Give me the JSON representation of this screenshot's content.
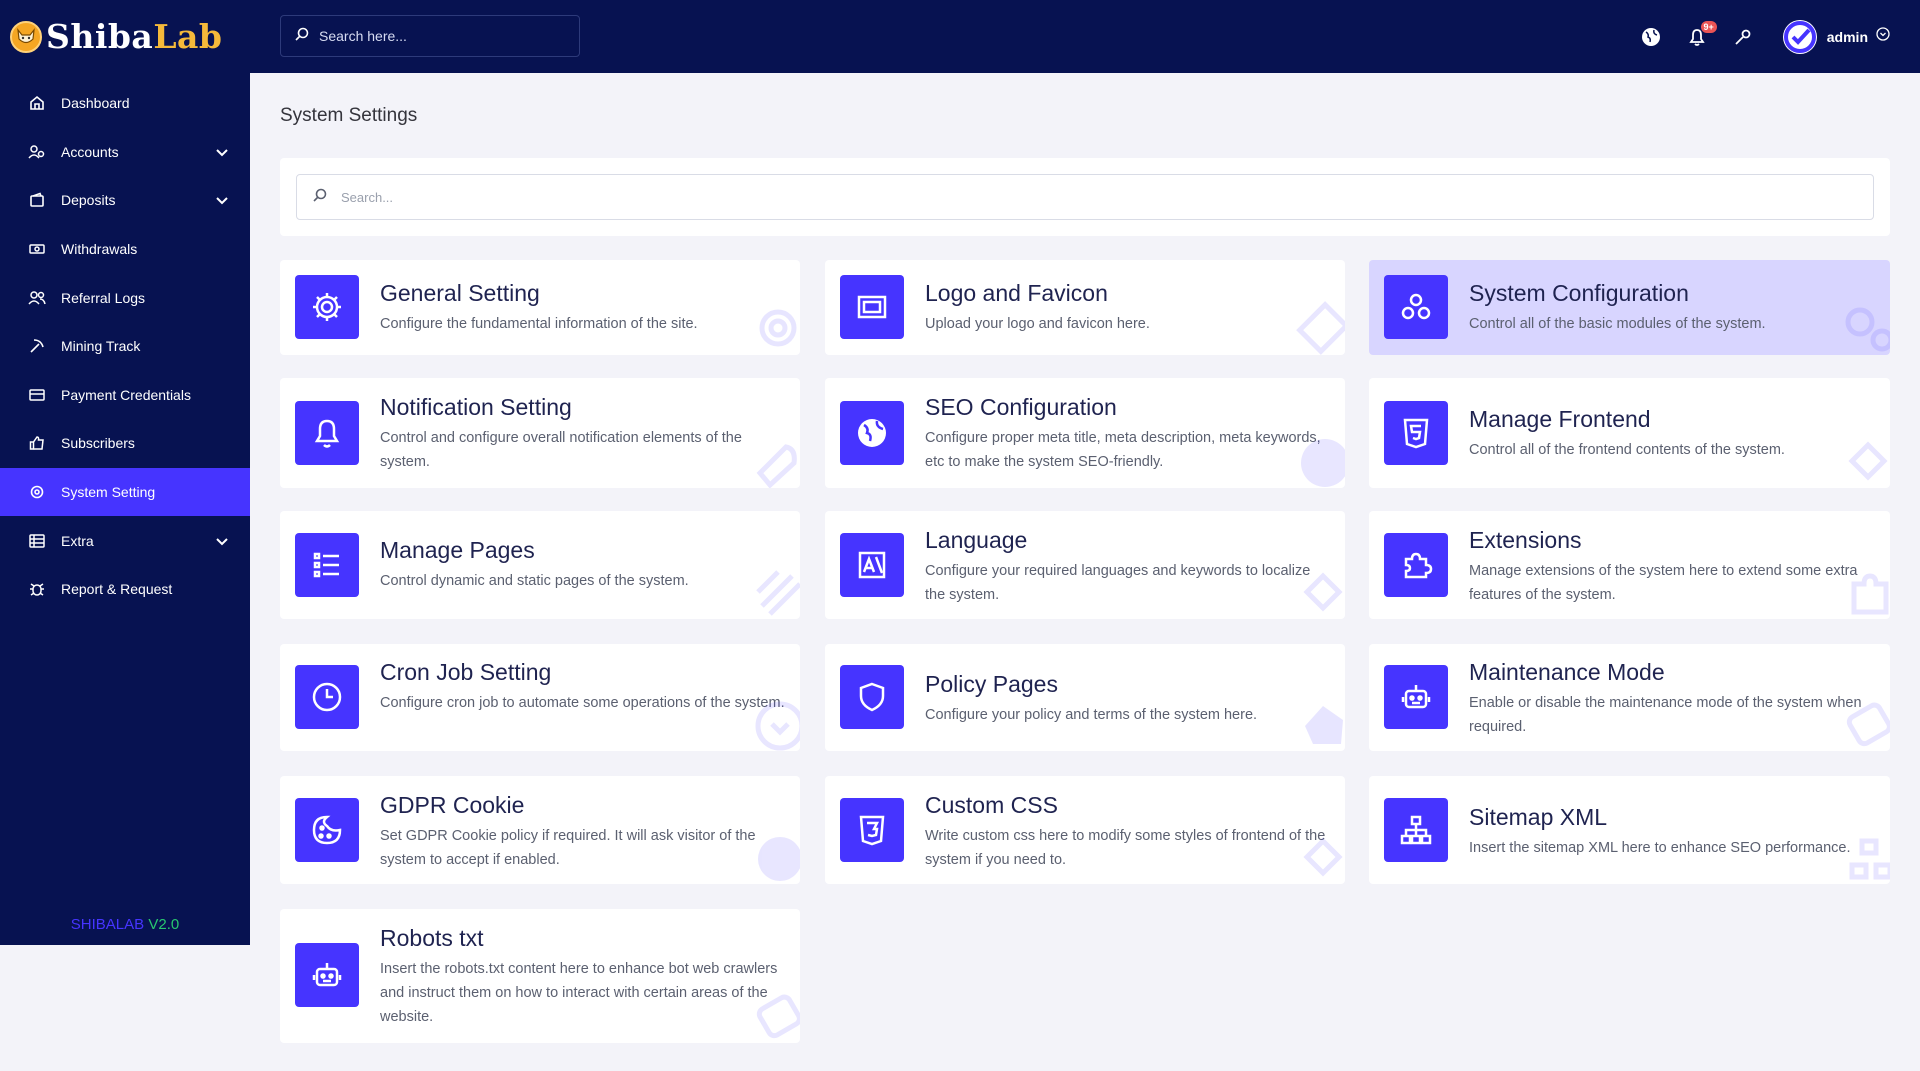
{
  "brand": {
    "name_a": "Shiba",
    "name_b": "Lab"
  },
  "sidebar": {
    "items": [
      {
        "label": "Dashboard"
      },
      {
        "label": "Accounts"
      },
      {
        "label": "Deposits"
      },
      {
        "label": "Withdrawals"
      },
      {
        "label": "Referral Logs"
      },
      {
        "label": "Mining Track"
      },
      {
        "label": "Payment Credentials"
      },
      {
        "label": "Subscribers"
      },
      {
        "label": "System Setting"
      },
      {
        "label": "Extra"
      },
      {
        "label": "Report & Request"
      }
    ],
    "version_name": "SHIBALAB",
    "version_num": "V2.0"
  },
  "topbar": {
    "search_placeholder": "Search here...",
    "notification_badge": "9+",
    "username": "admin"
  },
  "main": {
    "page_title": "System Settings",
    "search_placeholder": "Search...",
    "cards": [
      {
        "title": "General Setting",
        "desc": "Configure the fundamental information of the site."
      },
      {
        "title": "Logo and Favicon",
        "desc": "Upload your logo and favicon here."
      },
      {
        "title": "System Configuration",
        "desc": "Control all of the basic modules of the system."
      },
      {
        "title": "Notification Setting",
        "desc": "Control and configure overall notification elements of the system."
      },
      {
        "title": "SEO Configuration",
        "desc": "Configure proper meta title, meta description, meta keywords, etc to make the system SEO-friendly."
      },
      {
        "title": "Manage Frontend",
        "desc": "Control all of the frontend contents of the system."
      },
      {
        "title": "Manage Pages",
        "desc": "Control dynamic and static pages of the system."
      },
      {
        "title": "Language",
        "desc": "Configure your required languages and keywords to localize the system."
      },
      {
        "title": "Extensions",
        "desc": "Manage extensions of the system here to extend some extra features of the system."
      },
      {
        "title": "Cron Job Setting",
        "desc": "Configure cron job to automate some operations of the system."
      },
      {
        "title": "Policy Pages",
        "desc": "Configure your policy and terms of the system here."
      },
      {
        "title": "Maintenance Mode",
        "desc": "Enable or disable the maintenance mode of the system when required."
      },
      {
        "title": "GDPR Cookie",
        "desc": "Set GDPR Cookie policy if required. It will ask visitor of the system to accept if enabled."
      },
      {
        "title": "Custom CSS",
        "desc": "Write custom css here to modify some styles of frontend of the system if you need to."
      },
      {
        "title": "Sitemap XML",
        "desc": "Insert the sitemap XML here to enhance SEO performance."
      },
      {
        "title": "Robots txt",
        "desc": "Insert the robots.txt content here to enhance bot web crawlers and instruct them on how to interact with certain areas of the website."
      }
    ]
  },
  "colors": {
    "sidebar_bg": "#071251",
    "accent": "#4634ff",
    "page_bg": "#f3f3f9",
    "highlight": "#d8d5ff"
  }
}
